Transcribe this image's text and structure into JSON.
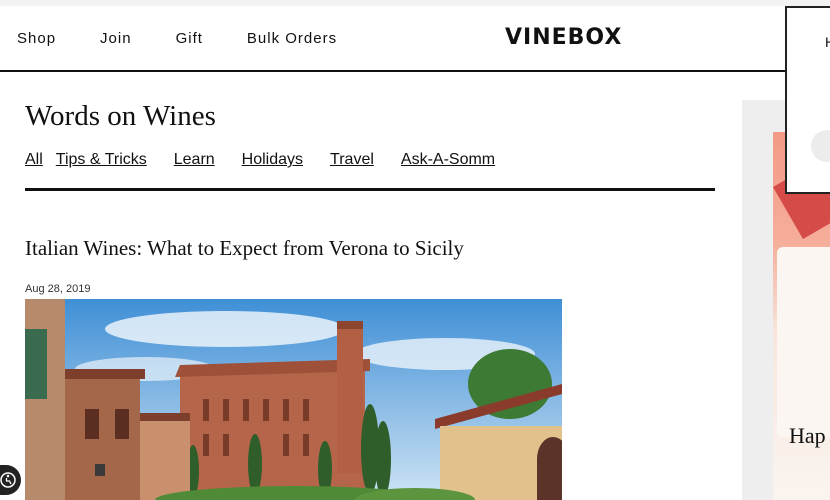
{
  "header": {
    "nav": [
      "Shop",
      "Join",
      "Gift",
      "Bulk Orders"
    ],
    "logo": "VINEBOX",
    "popup_text": "H"
  },
  "blog": {
    "title": "Words on Wines",
    "categories": [
      "All",
      "Tips & Tricks",
      "Learn",
      "Holidays",
      "Travel",
      "Ask-A-Somm"
    ]
  },
  "post": {
    "title": "Italian Wines: What to Expect from Verona to Sicily",
    "date": "Aug 28, 2019"
  },
  "ad": {
    "text": "Hap"
  },
  "colors": {
    "accent": "#111111",
    "ad_coral": "#f29a86"
  },
  "icons": [
    "accessibility-icon"
  ]
}
